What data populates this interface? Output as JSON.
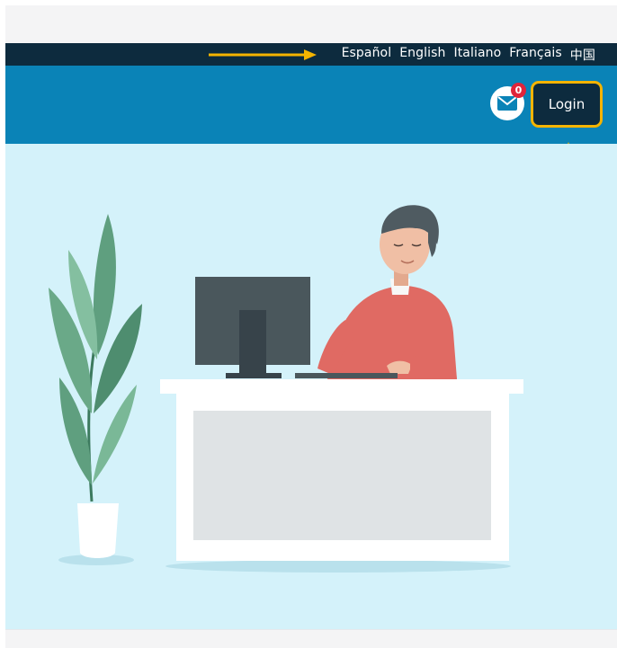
{
  "languages": [
    "Español",
    "English",
    "Italiano",
    "Français",
    "中国"
  ],
  "header": {
    "login_label": "Login",
    "mail_badge_count": "0",
    "mail_icon": "envelope-icon"
  },
  "colors": {
    "language_bar": "#0d2b3e",
    "header": "#0a83b7",
    "hero_background": "#d4f2fa",
    "highlight": "#f4b400",
    "badge": "#e0243a"
  }
}
